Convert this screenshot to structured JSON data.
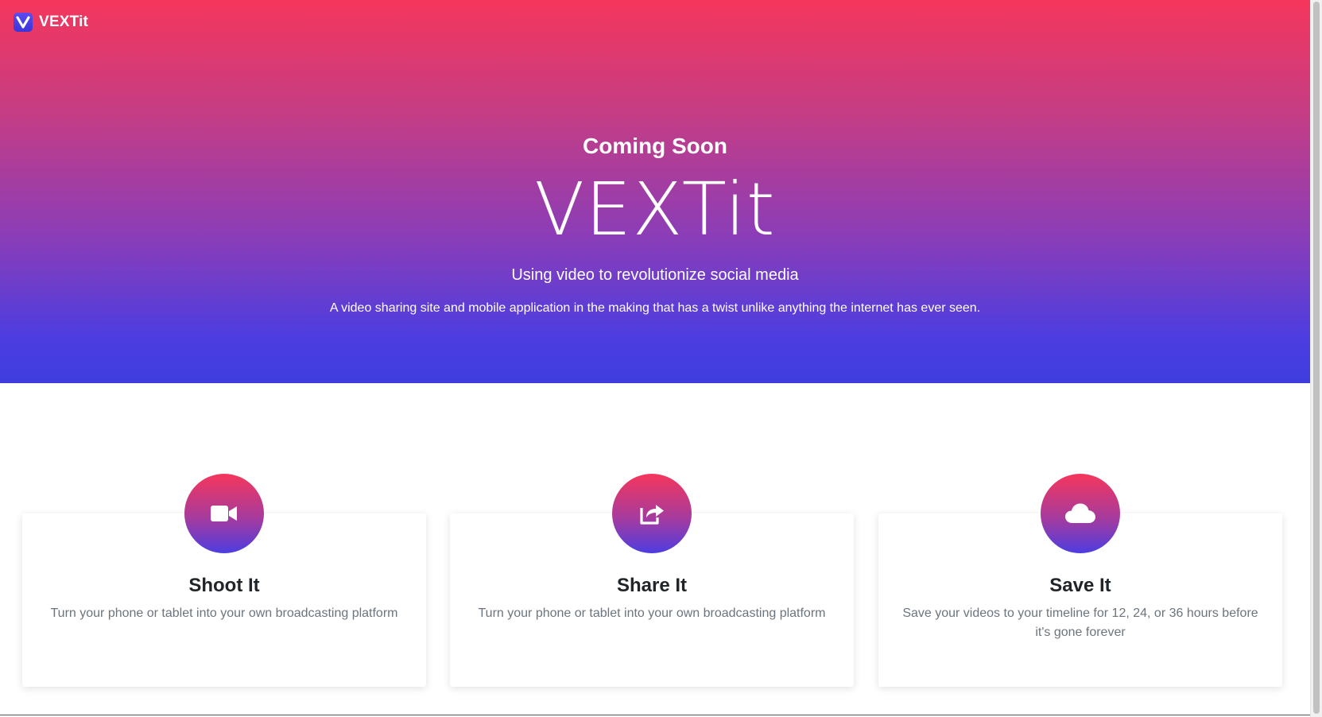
{
  "brand": {
    "name": "VEXTit",
    "logo_icon": "v-logo-icon"
  },
  "hero": {
    "eyebrow": "Coming Soon",
    "title": "VEXTit",
    "subtitle": "Using video to revolutionize social media",
    "description": "A video sharing site and mobile application in the making that has a twist unlike anything the internet has ever seen.",
    "gradient_colors": [
      "#f5365c",
      "#c43d85",
      "#8a3db8",
      "#4d3de0"
    ]
  },
  "features": [
    {
      "icon": "video-camera-icon",
      "title": "Shoot It",
      "text": "Turn your phone or tablet into your own broadcasting platform"
    },
    {
      "icon": "share-icon",
      "title": "Share It",
      "text": "Turn your phone or tablet into your own broadcasting platform"
    },
    {
      "icon": "cloud-icon",
      "title": "Save It",
      "text": "Save your videos to your timeline for 12, 24, or 36 hours before it's gone forever"
    }
  ]
}
